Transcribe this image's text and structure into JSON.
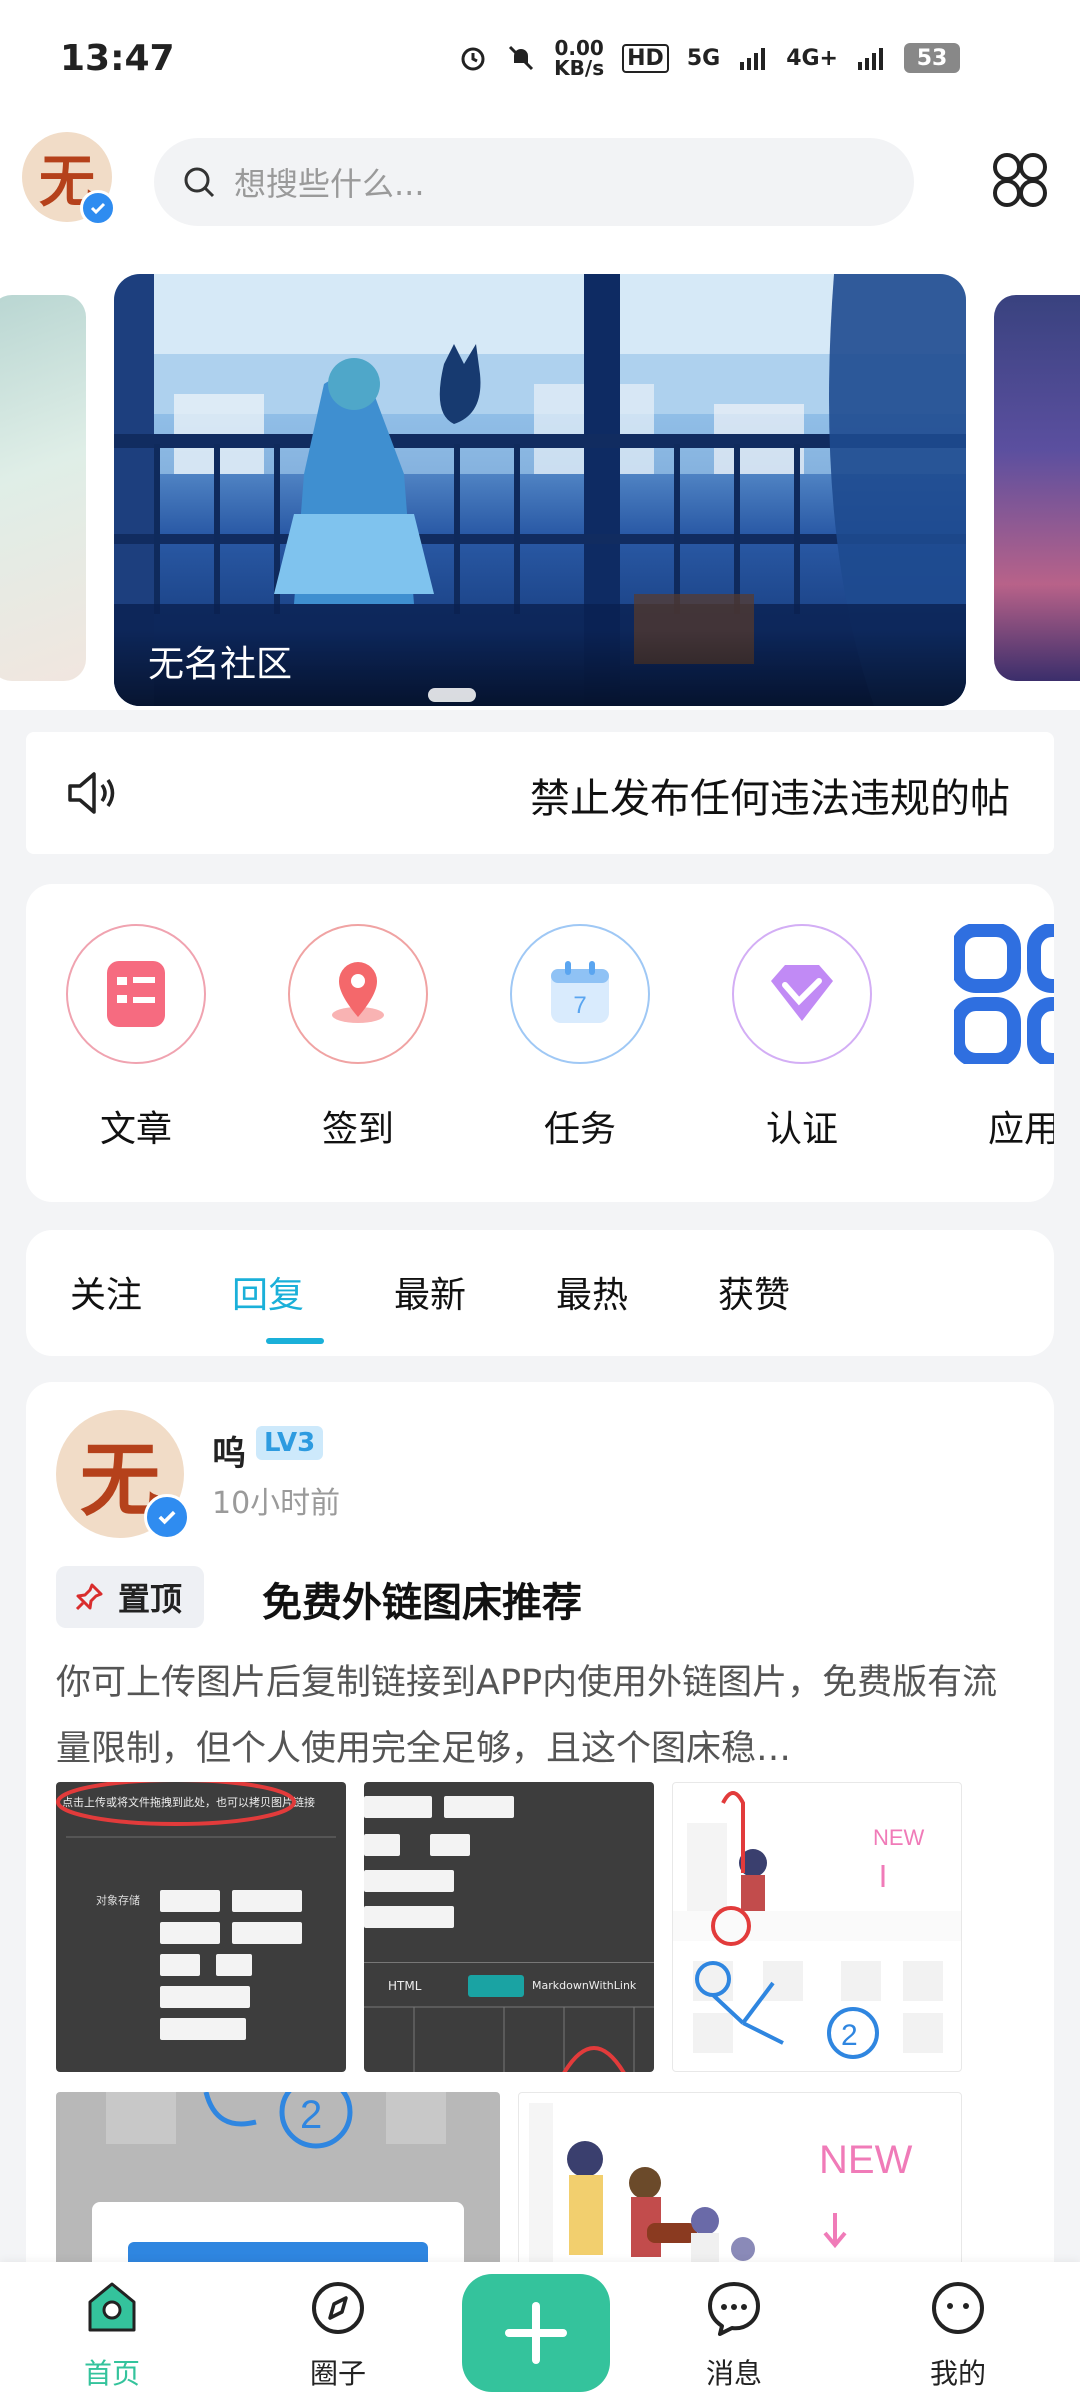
{
  "status_bar": {
    "time": "13:47",
    "net_speed_value": "0.00",
    "net_speed_unit": "KB/s",
    "hd_label": "HD",
    "network_1": "5G",
    "network_2": "4G+",
    "battery": "53"
  },
  "header": {
    "avatar_glyph": "无",
    "search_placeholder": "想搜些什么..."
  },
  "banner": {
    "caption": "无名社区"
  },
  "notice": {
    "text": "禁止发布任何违法违规的帖"
  },
  "quick_entries": [
    {
      "label": "文章",
      "icon": "article-icon",
      "color": "#f0526a"
    },
    {
      "label": "签到",
      "icon": "checkin-icon",
      "color": "#f06a6a"
    },
    {
      "label": "任务",
      "icon": "calendar-icon",
      "color": "#5aa5f0"
    },
    {
      "label": "认证",
      "icon": "verify-diamond-icon",
      "color": "#b06af0"
    },
    {
      "label": "应用",
      "icon": "apps-icon",
      "color": "#2f6fe0"
    }
  ],
  "tabs": [
    {
      "label": "关注"
    },
    {
      "label": "回复",
      "active": true
    },
    {
      "label": "最新"
    },
    {
      "label": "最热"
    },
    {
      "label": "获赞"
    }
  ],
  "post": {
    "avatar_glyph": "无",
    "author": "呜",
    "level": "LV3",
    "time": "10小时前",
    "pin_label": "置顶",
    "title": "免费外链图床推荐",
    "excerpt": "你可上传图片后复制链接到APP内使用外链图片，免费版有流量限制，但个人使用完全足够，且这个图床稳…",
    "thumb_texts": {
      "upload_hint": "点击上传或将文件拖拽到此处，也可以拷贝图片链接",
      "object_storage": "对象存储",
      "html_tab": "HTML",
      "markdown_tab": "MarkdownWithLink",
      "new_label": "NEW"
    }
  },
  "bottom_nav": [
    {
      "label": "首页",
      "active": true
    },
    {
      "label": "圈子"
    },
    {
      "label": "消息"
    },
    {
      "label": "我的"
    }
  ],
  "colors": {
    "accent": "#1ab0d9",
    "primary_green": "#34c39c",
    "verify_blue": "#2f8cf0"
  }
}
